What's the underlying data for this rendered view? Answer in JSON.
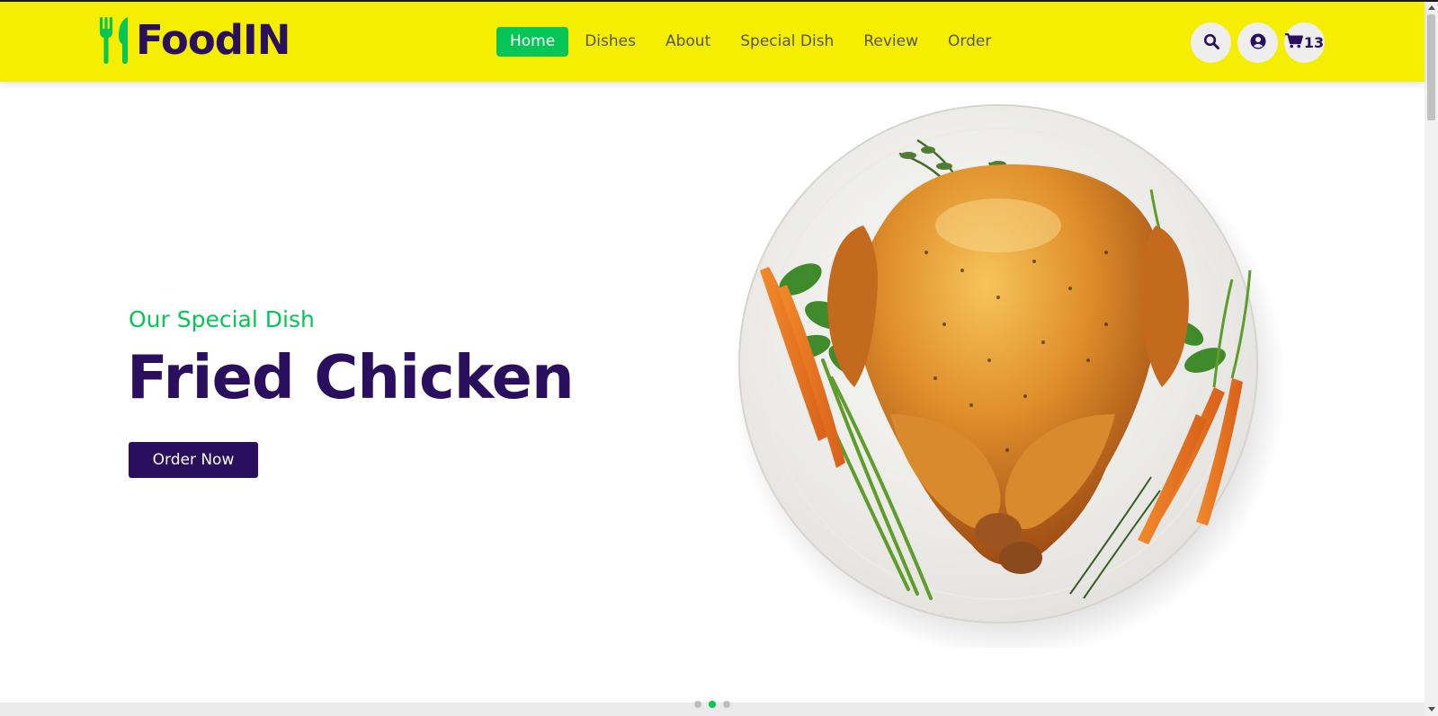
{
  "header": {
    "logo_text": "FoodIN",
    "logo_icon": "utensils-icon",
    "nav": [
      {
        "label": "Home",
        "active": true
      },
      {
        "label": "Dishes"
      },
      {
        "label": "About"
      },
      {
        "label": "Special Dish"
      },
      {
        "label": "Review"
      },
      {
        "label": "Order"
      }
    ],
    "icons": {
      "search": "search-icon",
      "user": "user-circle-icon",
      "cart": "cart-icon"
    },
    "cart_count": "13"
  },
  "hero": {
    "subtitle": "Our Special Dish",
    "title": "Fried Chicken",
    "button_label": "Order Now",
    "image_description": "roasted-chicken-plate"
  },
  "slider": {
    "total": 3,
    "active_index": 1
  },
  "colors": {
    "header_bg": "#f5ee00",
    "brand_purple": "#2a0f5f",
    "accent_green": "#05c557"
  }
}
